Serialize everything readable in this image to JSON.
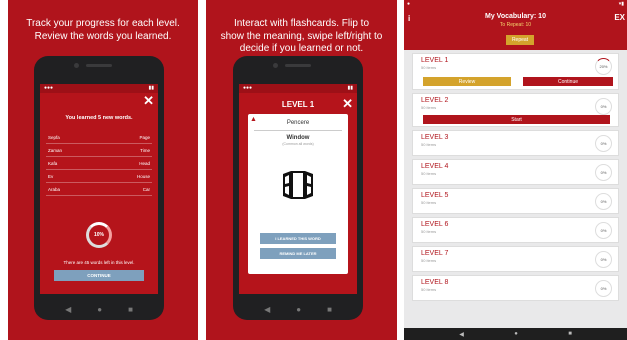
{
  "panel1": {
    "caption_line1": "Track your progress for each level.",
    "caption_line2": "Review the words you learned.",
    "close_glyph": "✕",
    "learned_title": "You learned 5 new words.",
    "rows": [
      {
        "left": "Sepfa",
        "right": "Page"
      },
      {
        "left": "Zaman",
        "right": "Time"
      },
      {
        "left": "Kafa",
        "right": "Head"
      },
      {
        "left": "Ev",
        "right": "House"
      },
      {
        "left": "Araba",
        "right": "Car"
      }
    ],
    "progress_label": "10%",
    "progress_value": 0.1,
    "remaining_text": "There are 45 words left in this level.",
    "continue_label": "CONTINUE",
    "nav_back": "◀",
    "nav_home": "●",
    "nav_recent": "■"
  },
  "panel2": {
    "caption_line1": "Interact with flashcards. Flip to",
    "caption_line2": "show the meaning, swipe left/right to",
    "caption_line3": "decide if you learned or not.",
    "level_title": "LEVEL 1",
    "close_glyph": "✕",
    "warn_glyph": "▲",
    "card_word": "Pencere",
    "card_meaning": "Window",
    "card_sub": "(Common all words)",
    "learned_btn": "I LEARNED THIS WORD",
    "remind_btn": "REMIND ME LATER",
    "nav_back": "◀",
    "nav_home": "●",
    "nav_recent": "■"
  },
  "app": {
    "title": "My Vocabulary: 10",
    "to_repeat": "To Repeat: 10",
    "repeat_label": "Repeat",
    "menu_glyph": "i",
    "exit_label": "EX",
    "levels": [
      {
        "name": "LEVEL 1",
        "items": "50 items",
        "percent": "20%",
        "fill": 0.2
      },
      {
        "name": "LEVEL 2",
        "items": "50 items",
        "percent": "0%",
        "fill": 0
      },
      {
        "name": "LEVEL 3",
        "items": "50 items",
        "percent": "0%",
        "fill": 0
      },
      {
        "name": "LEVEL 4",
        "items": "50 items",
        "percent": "0%",
        "fill": 0
      },
      {
        "name": "LEVEL 5",
        "items": "50 items",
        "percent": "0%",
        "fill": 0
      },
      {
        "name": "LEVEL 6",
        "items": "50 items",
        "percent": "0%",
        "fill": 0
      },
      {
        "name": "LEVEL 7",
        "items": "50 items",
        "percent": "0%",
        "fill": 0
      },
      {
        "name": "LEVEL 8",
        "items": "50 items",
        "percent": "0%",
        "fill": 0
      }
    ],
    "review_label": "Review",
    "continue_label": "Continue",
    "start_label": "Start",
    "nav_back": "◀",
    "nav_home": "●",
    "nav_recent": "■"
  },
  "colors": {
    "brand_red": "#b0141c",
    "accent_gold": "#d4a32c",
    "button_blue": "#7ea0bd"
  }
}
